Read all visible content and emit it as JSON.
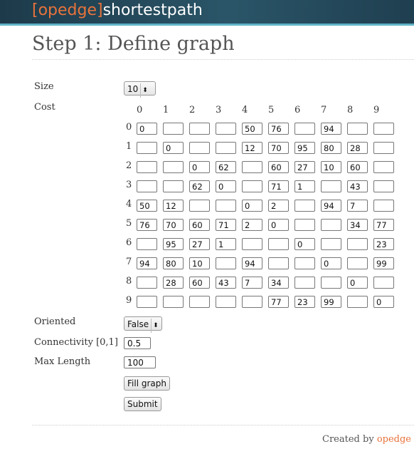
{
  "header": {
    "brand": "[opedge]",
    "app_name": "shortestpath"
  },
  "page_title": "Step 1: Define graph",
  "form": {
    "size_label": "Size",
    "size_value": "10",
    "cost_label": "Cost",
    "oriented_label": "Oriented",
    "oriented_value": "False",
    "connectivity_label": "Connectivity [0,1]",
    "connectivity_value": "0.5",
    "max_length_label": "Max Length",
    "max_length_value": "100",
    "fill_button": "Fill graph",
    "submit_button": "Submit"
  },
  "matrix": {
    "indices": [
      "0",
      "1",
      "2",
      "3",
      "4",
      "5",
      "6",
      "7",
      "8",
      "9"
    ],
    "rows": [
      [
        "0",
        "",
        "",
        "",
        "50",
        "76",
        "",
        "94",
        "",
        ""
      ],
      [
        "",
        "0",
        "",
        "",
        "12",
        "70",
        "95",
        "80",
        "28",
        ""
      ],
      [
        "",
        "",
        "0",
        "62",
        "",
        "60",
        "27",
        "10",
        "60",
        ""
      ],
      [
        "",
        "",
        "62",
        "0",
        "",
        "71",
        "1",
        "",
        "43",
        ""
      ],
      [
        "50",
        "12",
        "",
        "",
        "0",
        "2",
        "",
        "94",
        "7",
        ""
      ],
      [
        "76",
        "70",
        "60",
        "71",
        "2",
        "0",
        "",
        "",
        "34",
        "77"
      ],
      [
        "",
        "95",
        "27",
        "1",
        "",
        "",
        "0",
        "",
        "",
        "23"
      ],
      [
        "94",
        "80",
        "10",
        "",
        "94",
        "",
        "",
        "0",
        "",
        "99"
      ],
      [
        "",
        "28",
        "60",
        "43",
        "7",
        "34",
        "",
        "",
        "0",
        ""
      ],
      [
        "",
        "",
        "",
        "",
        "",
        "77",
        "23",
        "99",
        "",
        "0"
      ]
    ]
  },
  "footer": {
    "created_by": "Created by",
    "author": "opedge"
  }
}
